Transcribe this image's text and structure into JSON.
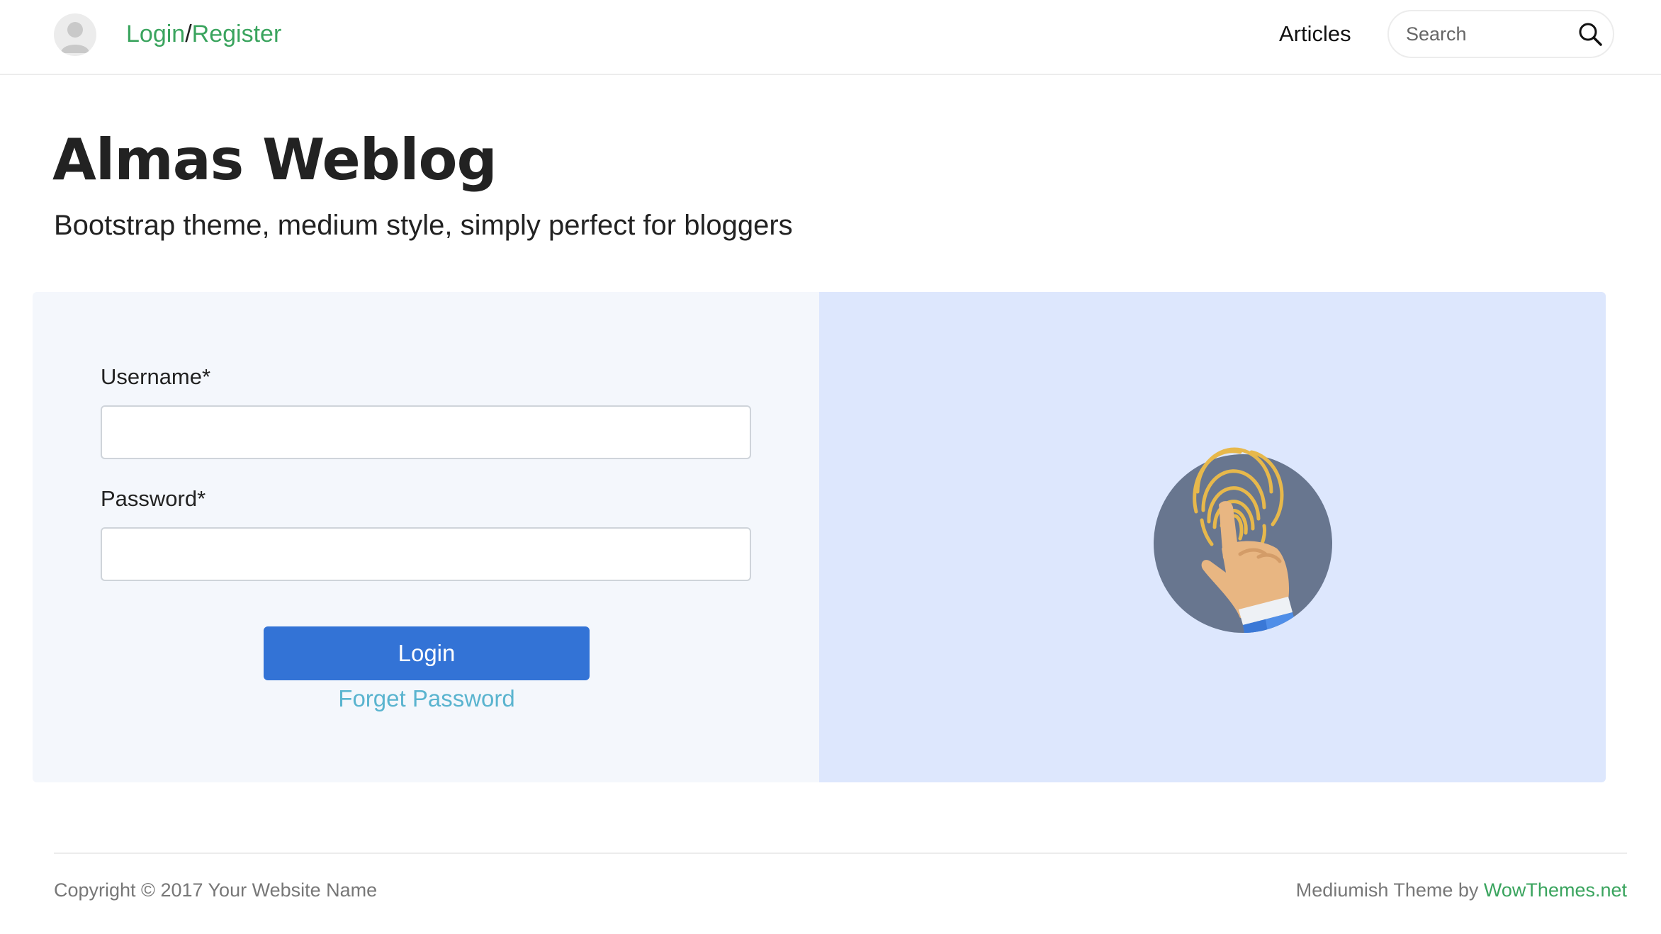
{
  "header": {
    "login_label": "Login",
    "separator": "/",
    "register_label": "Register",
    "nav_articles": "Articles",
    "search_placeholder": "Search",
    "avatar_icon": "user-avatar-icon",
    "search_icon": "search-icon"
  },
  "hero": {
    "title": "Almas Weblog",
    "subtitle": "Bootstrap theme, medium style, simply perfect for bloggers"
  },
  "login_form": {
    "username_label": "Username*",
    "username_value": "",
    "password_label": "Password*",
    "password_value": "",
    "submit_label": "Login",
    "forget_password_label": "Forget Password",
    "illustration_icon": "fingerprint-touch-icon"
  },
  "footer": {
    "copyright": "Copyright © 2017 Your Website Name",
    "credit_prefix": "Mediumish Theme by",
    "credit_link": "WowThemes.net"
  },
  "colors": {
    "accent_green": "#3aa45e",
    "button_blue": "#3373d6",
    "link_teal": "#5ab4cf",
    "form_panel_bg": "#f4f7fc",
    "illustration_panel_bg": "#dde7fd"
  }
}
